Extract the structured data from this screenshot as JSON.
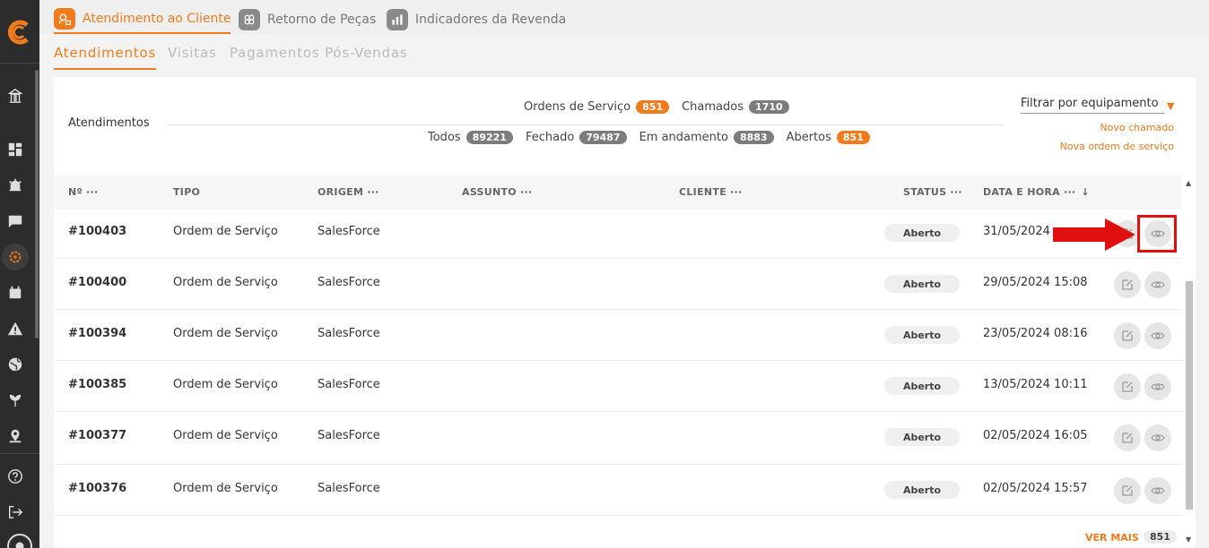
{
  "app": {
    "top_tabs": [
      {
        "label": "Atendimento ao Cliente",
        "active": true
      },
      {
        "label": "Retorno de Peças",
        "active": false
      },
      {
        "label": "Indicadores da Revenda",
        "active": false
      }
    ],
    "sub_tabs": [
      {
        "label": "Atendimentos",
        "active": true
      },
      {
        "label": "Visitas",
        "active": false
      },
      {
        "label": "Pagamentos Pós-Vendas",
        "active": false
      }
    ],
    "accent_color": "#f07b1d"
  },
  "panel": {
    "title": "Atendimentos",
    "stats_top": [
      {
        "label": "Ordens de Serviço",
        "count": "851",
        "color": "orange"
      },
      {
        "label": "Chamados",
        "count": "1710",
        "color": "gray"
      }
    ],
    "stats_bottom": [
      {
        "label": "Todos",
        "count": "89221",
        "color": "gray"
      },
      {
        "label": "Fechado",
        "count": "79487",
        "color": "gray"
      },
      {
        "label": "Em andamento",
        "count": "8883",
        "color": "gray"
      },
      {
        "label": "Abertos",
        "count": "851",
        "color": "orange"
      }
    ],
    "filter_label": "Filtrar por equipamento",
    "links": {
      "new_ticket": "Novo chamado",
      "new_order": "Nova ordem de serviço"
    }
  },
  "table": {
    "columns": {
      "number": "Nº",
      "type": "TIPO",
      "origin": "ORIGEM",
      "subject": "ASSUNTO",
      "client": "CLIENTE",
      "status": "STATUS",
      "datetime": "DATA E HORA",
      "dots": "···"
    },
    "rows": [
      {
        "number": "#100403",
        "type": "Ordem de Serviço",
        "origin": "SalesForce",
        "status": "Aberto",
        "datetime": "31/05/2024"
      },
      {
        "number": "#100400",
        "type": "Ordem de Serviço",
        "origin": "SalesForce",
        "status": "Aberto",
        "datetime": "29/05/2024 15:08"
      },
      {
        "number": "#100394",
        "type": "Ordem de Serviço",
        "origin": "SalesForce",
        "status": "Aberto",
        "datetime": "23/05/2024 08:16"
      },
      {
        "number": "#100385",
        "type": "Ordem de Serviço",
        "origin": "SalesForce",
        "status": "Aberto",
        "datetime": "13/05/2024 10:11"
      },
      {
        "number": "#100377",
        "type": "Ordem de Serviço",
        "origin": "SalesForce",
        "status": "Aberto",
        "datetime": "02/05/2024 16:05"
      },
      {
        "number": "#100376",
        "type": "Ordem de Serviço",
        "origin": "SalesForce",
        "status": "Aberto",
        "datetime": "02/05/2024 15:57"
      }
    ],
    "footer": {
      "see_more": "VER MAIS",
      "count": "851"
    }
  },
  "sidebar_icons": [
    "logo-icon",
    "building-icon",
    "dashboard-icon",
    "alarm-icon",
    "chat-icon",
    "gear-service-icon",
    "calendar-icon",
    "warning-icon",
    "globe-icon",
    "plant-icon",
    "map-pin-icon",
    "help-icon",
    "logout-icon",
    "user-icon"
  ]
}
